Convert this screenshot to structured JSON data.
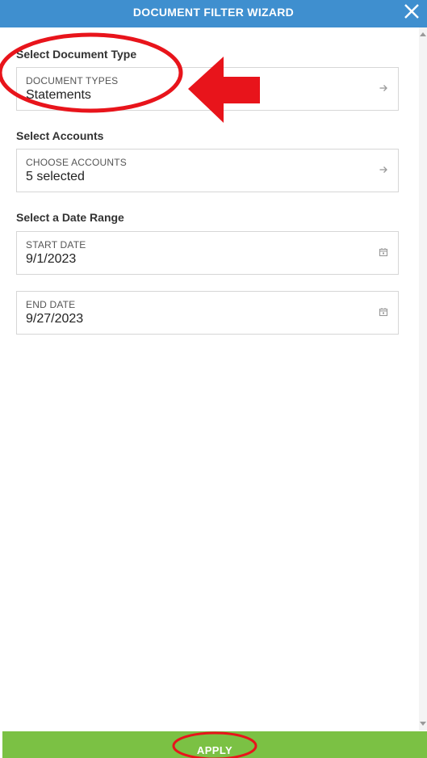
{
  "header": {
    "title": "DOCUMENT FILTER WIZARD"
  },
  "sections": {
    "document_type": {
      "heading": "Select Document Type",
      "field_label": "DOCUMENT TYPES",
      "field_value": "Statements",
      "icon": "arrow-right-icon"
    },
    "accounts": {
      "heading": "Select Accounts",
      "field_label": "CHOOSE ACCOUNTS",
      "field_value": "5 selected",
      "icon": "arrow-right-icon"
    },
    "date_range": {
      "heading": "Select a Date Range",
      "start": {
        "field_label": "START DATE",
        "field_value": "9/1/2023",
        "icon": "calendar-icon"
      },
      "end": {
        "field_label": "END DATE",
        "field_value": "9/27/2023",
        "icon": "calendar-icon"
      }
    }
  },
  "footer": {
    "apply_label": "APPLY"
  },
  "colors": {
    "header": "#3f8fcf",
    "apply": "#7bc144",
    "annotation": "#e8141b"
  }
}
